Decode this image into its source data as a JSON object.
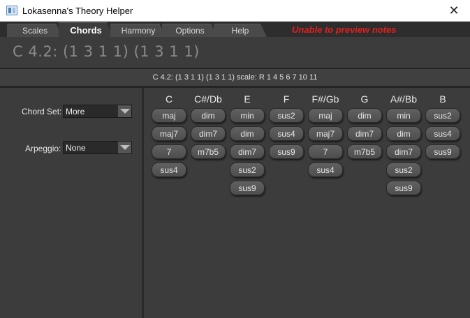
{
  "window": {
    "title": "Lokasenna's Theory Helper",
    "close_glyph": "✕"
  },
  "tabs": [
    {
      "label": "Scales",
      "active": false
    },
    {
      "label": "Chords",
      "active": true
    },
    {
      "label": "Harmony",
      "active": false
    },
    {
      "label": "Options",
      "active": false
    },
    {
      "label": "Help",
      "active": false
    }
  ],
  "warning": "Unable to preview notes",
  "chord_display": "C 4.2: (1  3  1  1)  (1  3  1  1)",
  "info_line": "C 4.2: (1  3  1  1)  (1  3  1  1) scale:  R 1 4 5 6 7 10 11",
  "controls": {
    "chord_set_label": "Chord Set:",
    "chord_set_value": "More",
    "arpeggio_label": "Arpeggio:",
    "arpeggio_value": "None"
  },
  "roots": [
    {
      "name": "C",
      "chords": [
        "maj",
        "maj7",
        "7",
        "sus4"
      ]
    },
    {
      "name": "C#/Db",
      "chords": [
        "dim",
        "dim7",
        "m7b5"
      ]
    },
    {
      "name": "E",
      "chords": [
        "min",
        "dim",
        "dim7",
        "sus2",
        "sus9"
      ]
    },
    {
      "name": "F",
      "chords": [
        "sus2",
        "sus4",
        "sus9"
      ]
    },
    {
      "name": "F#/Gb",
      "chords": [
        "maj",
        "maj7",
        "7",
        "sus4"
      ]
    },
    {
      "name": "G",
      "chords": [
        "dim",
        "dim7",
        "m7b5"
      ]
    },
    {
      "name": "A#/Bb",
      "chords": [
        "min",
        "dim",
        "dim7",
        "sus2",
        "sus9"
      ]
    },
    {
      "name": "B",
      "chords": [
        "sus2",
        "sus4",
        "sus9"
      ]
    }
  ],
  "colors": {
    "background": "#3c3c3c",
    "warning": "#e02020",
    "button": "#575757"
  }
}
